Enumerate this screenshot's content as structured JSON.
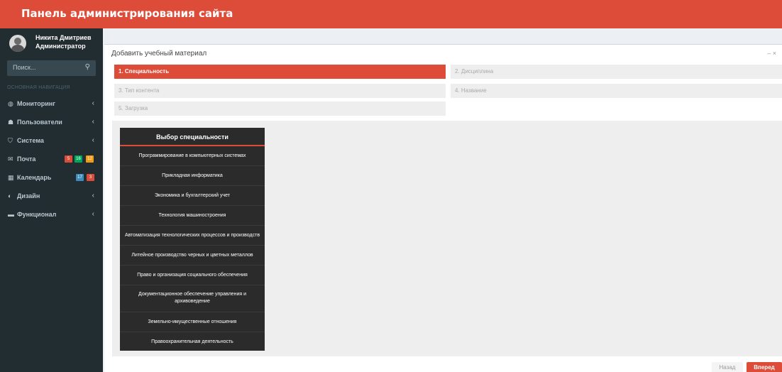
{
  "topbar": {
    "title": "Панель администрирования сайта"
  },
  "user": {
    "name": "Никита Дмитриев",
    "role": "Администратор"
  },
  "search": {
    "placeholder": "Поиск...",
    "icon": "search-icon"
  },
  "nav": {
    "header": "ОСНОВНАЯ НАВИГАЦИЯ",
    "items": [
      {
        "label": "Мониторинг",
        "icon": "dashboard-icon",
        "glyph": "◍",
        "chevron": "‹"
      },
      {
        "label": "Пользователи",
        "icon": "users-icon",
        "glyph": "☗",
        "chevron": "‹"
      },
      {
        "label": "Система",
        "icon": "shield-icon",
        "glyph": "⛉",
        "chevron": "‹"
      },
      {
        "label": "Почта",
        "icon": "envelope-icon",
        "glyph": "✉",
        "badges": [
          {
            "text": "5",
            "color": "#dd4b39"
          },
          {
            "text": "16",
            "color": "#00a65a"
          },
          {
            "text": "12",
            "color": "#f39c12"
          }
        ]
      },
      {
        "label": "Календарь",
        "icon": "calendar-icon",
        "glyph": "▦",
        "badges": [
          {
            "text": "17",
            "color": "#3c8dbc"
          },
          {
            "text": "3",
            "color": "#dd4b39"
          }
        ]
      },
      {
        "label": "Дизайн",
        "icon": "palette-icon",
        "glyph": "◐",
        "chevron": "‹"
      },
      {
        "label": "Функционал",
        "icon": "folder-icon",
        "glyph": "▬",
        "chevron": "‹"
      }
    ]
  },
  "box": {
    "title": "Добавить учебный материал",
    "tools": "–  ×"
  },
  "steps": [
    {
      "label": "1. Специальность",
      "active": true
    },
    {
      "label": "2. Дисциплина",
      "active": false
    },
    {
      "label": "3. Тип контента",
      "active": false
    },
    {
      "label": "4. Название",
      "active": false
    },
    {
      "label": "5. Загрузка",
      "active": false
    }
  ],
  "specialties": {
    "header": "Выбор специальности",
    "items": [
      "Программирование в компьютерных системах",
      "Прикладная информатика",
      "Экономика и бухгалтерский учет",
      "Технология машиностроения",
      "Автоматизация технологических процессов и производств",
      "Литейное производство черных и цветных металлов",
      "Право и организация социального обеспечения",
      "Документационное обеспечение управления и архивоведение",
      "Земельно-имущественные отношения",
      "Правоохранительная деятельность"
    ]
  },
  "buttons": {
    "back": "Назад",
    "next": "Вперед"
  },
  "colors": {
    "accent": "#dd4b39",
    "sidebar": "#222d32",
    "content_bg": "#ecf0f5"
  }
}
